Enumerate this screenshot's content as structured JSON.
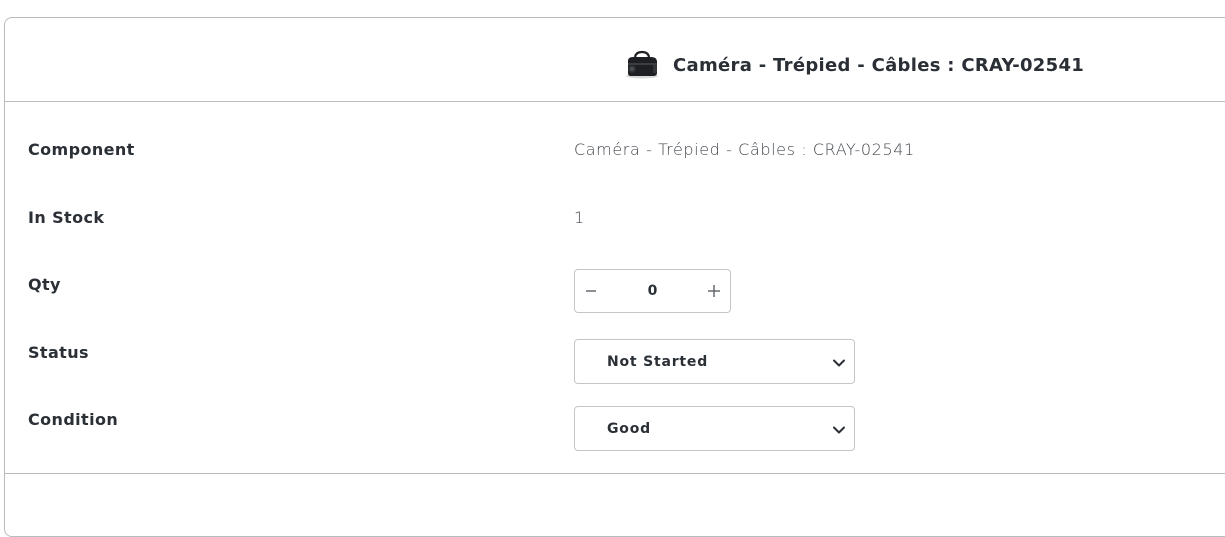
{
  "header": {
    "icon": "duffel-bag-icon",
    "title": "Caméra - Trépied - Câbles : CRAY-02541"
  },
  "rows": {
    "component": {
      "label": "Component",
      "value": "Caméra - Trépied - Câbles : CRAY-02541"
    },
    "in_stock": {
      "label": "In Stock",
      "value": "1"
    },
    "qty": {
      "label": "Qty",
      "value": "0",
      "decrement_icon": "minus-icon",
      "increment_icon": "plus-icon"
    },
    "status": {
      "label": "Status",
      "selected": "Not Started"
    },
    "condition": {
      "label": "Condition",
      "selected": "Good"
    }
  }
}
